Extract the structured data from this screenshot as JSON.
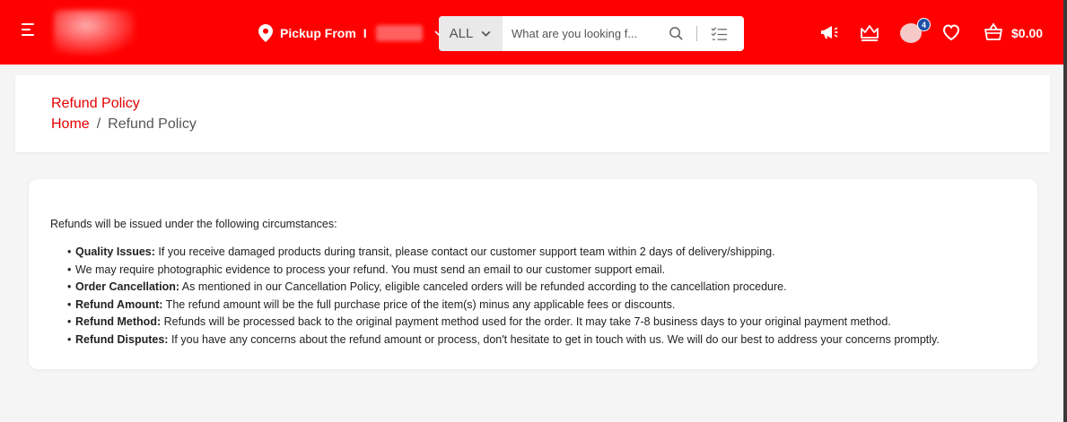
{
  "header": {
    "pickup_label": "Pickup From",
    "pickup_separator": "I",
    "search": {
      "category": "ALL",
      "placeholder": "What are you looking f..."
    },
    "notification_count": "4",
    "cart_total": "$0.00",
    "icons": [
      "menu-icon",
      "location-pin-icon",
      "chevron-down-icon",
      "search-icon",
      "list-checks-icon",
      "megaphone-icon",
      "crown-icon",
      "heart-icon",
      "basket-icon"
    ]
  },
  "page": {
    "title": "Refund Policy",
    "breadcrumb": {
      "home": "Home",
      "separator": "/",
      "current": "Refund Policy"
    }
  },
  "content": {
    "intro": "Refunds will be issued under the following circumstances:",
    "items": [
      {
        "heading": "Quality Issues:",
        "text": " If you receive damaged products during transit, please contact our customer support team within 2 days of delivery/shipping."
      },
      {
        "heading": "",
        "text": "We may require photographic evidence to process your refund. You must send an email to our customer support email."
      },
      {
        "heading": "Order Cancellation:",
        "text": " As mentioned in our Cancellation Policy, eligible canceled orders will be refunded according to the cancellation procedure."
      },
      {
        "heading": "Refund Amount:",
        "text": " The refund amount will be the full purchase price of the item(s) minus any applicable fees or discounts."
      },
      {
        "heading": "Refund Method:",
        "text": " Refunds will be processed back to the original payment method used for the order. It may take 7-8 business days to your original payment method."
      },
      {
        "heading": "Refund Disputes:",
        "text": " If you have any concerns about the refund amount or process, don't hesitate to get in touch with us. We will do our best to address your concerns promptly."
      }
    ]
  },
  "colors": {
    "brand": "#ff0000",
    "accent_text": "#e50000",
    "badge": "#1e4fa6"
  }
}
